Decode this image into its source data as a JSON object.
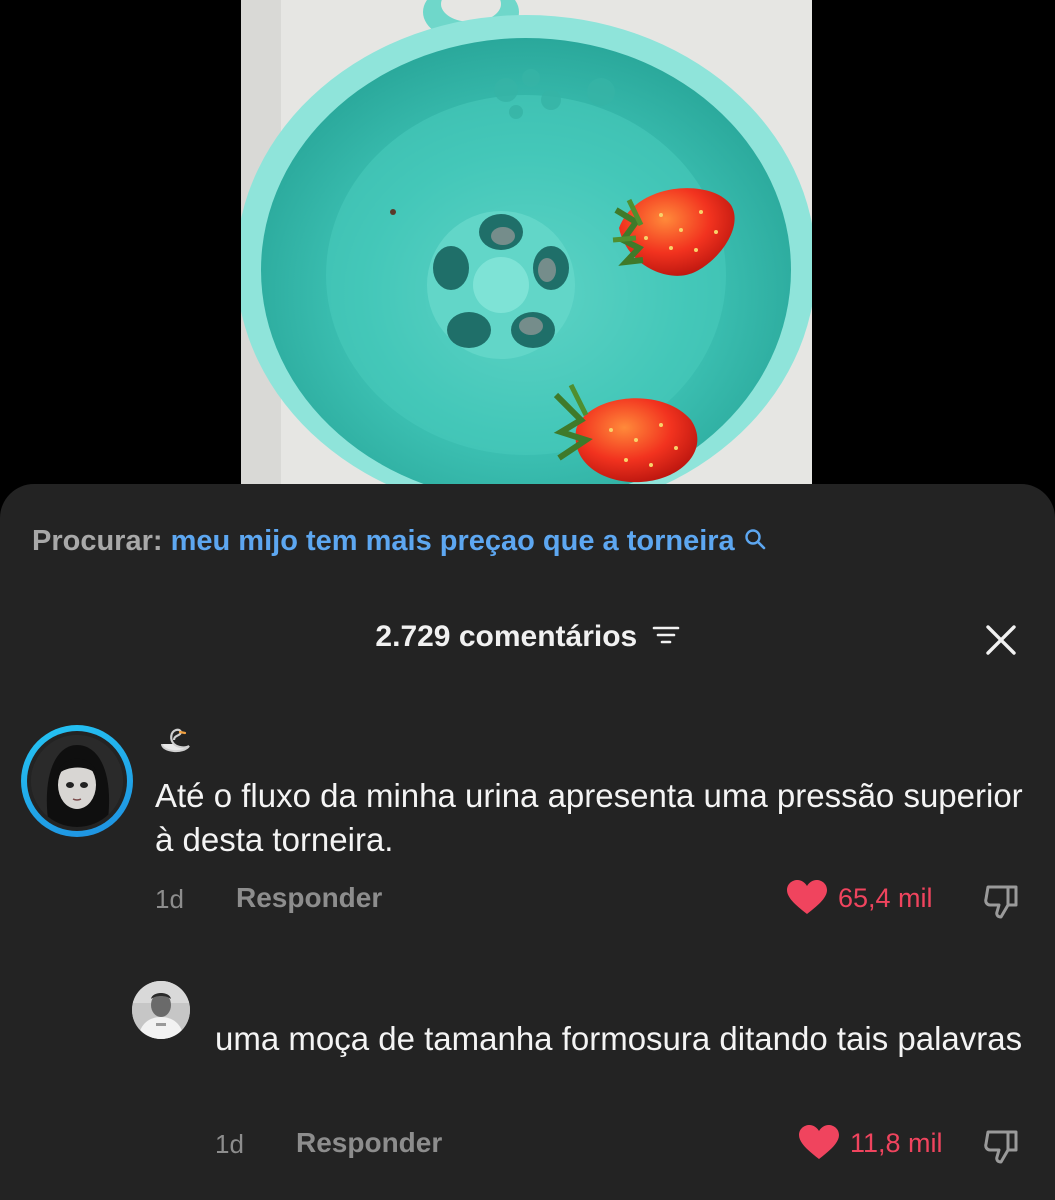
{
  "search": {
    "prefix": "Procurar:",
    "query": "meu mijo tem mais preçao que a torneira",
    "icon": "search-icon"
  },
  "comments_header": {
    "count_label": "2.729 comentários",
    "sort_icon": "sort-icon",
    "close_icon": "close-icon"
  },
  "comments": [
    {
      "author_badge": "🦢",
      "text": "Até o fluxo da minha urina apresenta uma pressão superior à desta torneira.",
      "time": "1d",
      "reply_label": "Responder",
      "likes": "65,4 mil"
    },
    {
      "text": "uma moça de tamanha formosura ditando tais palavras",
      "time": "1d",
      "reply_label": "Responder",
      "likes": "11,8 mil"
    }
  ],
  "colors": {
    "sheet_bg": "#232323",
    "link_blue": "#5da7f1",
    "like_red": "#f0445e",
    "avatar_ring": "#25c6f4"
  }
}
